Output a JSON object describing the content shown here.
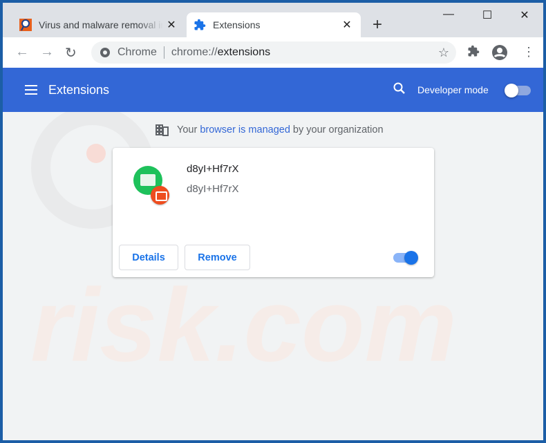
{
  "tabs": [
    {
      "title": "Virus and malware removal instructions",
      "icon": "pcrisk-favicon"
    },
    {
      "title": "Extensions",
      "icon": "puzzle-icon"
    }
  ],
  "window_controls": {
    "minimize": "—",
    "maximize": "☐",
    "close": "✕"
  },
  "omnibox": {
    "site_label": "Chrome",
    "url_prefix": "chrome://",
    "url_path": "extensions"
  },
  "header": {
    "title": "Extensions",
    "developer_mode_label": "Developer mode",
    "developer_mode": false
  },
  "managed_notice": {
    "before": "Your ",
    "link": "browser is managed",
    "after": " by your organization"
  },
  "extension": {
    "name": "d8yI+Hf7rX",
    "description": "d8yI+Hf7rX",
    "details_label": "Details",
    "remove_label": "Remove",
    "enabled": true
  },
  "watermark": "PCrisk.com",
  "colors": {
    "header": "#3367d6",
    "accent": "#1a73e8",
    "icon_green": "#1ec15b",
    "badge_red": "#ee4d1f"
  }
}
